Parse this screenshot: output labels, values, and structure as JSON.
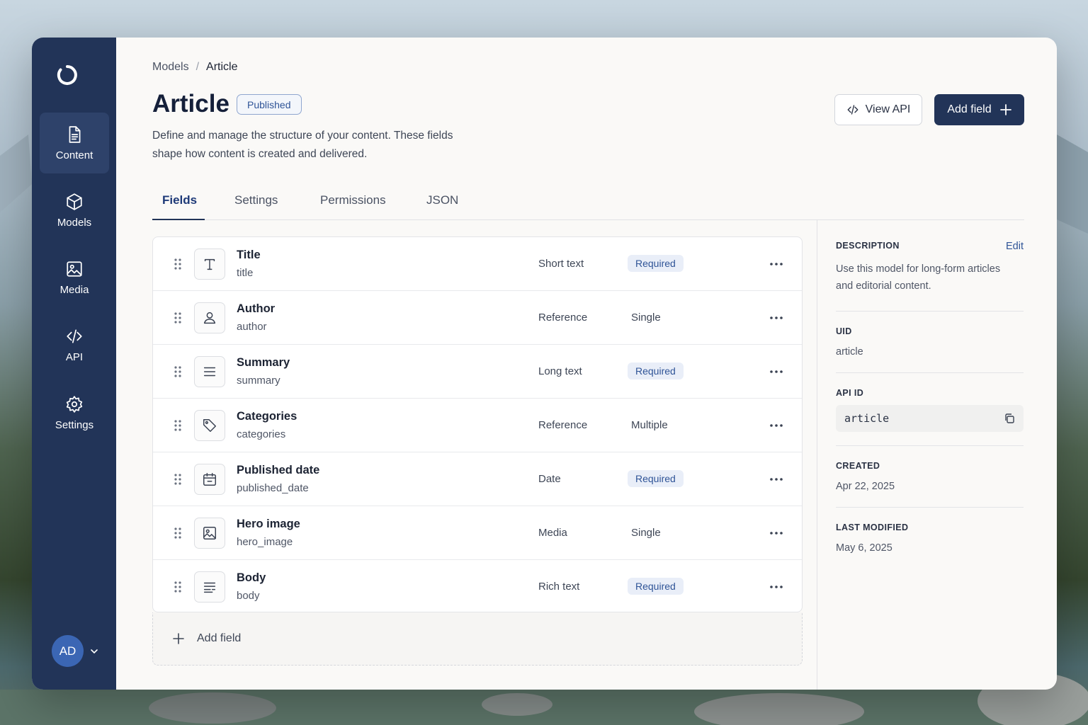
{
  "sidebar": {
    "items": [
      {
        "label": "Content",
        "icon": "file-text-icon",
        "active": true
      },
      {
        "label": "Models",
        "icon": "cube-icon",
        "active": false
      },
      {
        "label": "Media",
        "icon": "image-icon",
        "active": false
      },
      {
        "label": "API",
        "icon": "code-icon",
        "active": false
      },
      {
        "label": "Settings",
        "icon": "gear-icon",
        "active": false
      }
    ],
    "avatar_initials": "AD"
  },
  "breadcrumb": {
    "parent": "Models",
    "separator": "/",
    "current": "Article"
  },
  "header": {
    "title": "Article",
    "status_badge": "Published",
    "description": "Define and manage the structure of your content. These fields shape how content is created and delivered.",
    "view_api_label": "View API",
    "add_field_label": "Add field"
  },
  "tabs": [
    {
      "label": "Fields",
      "active": true
    },
    {
      "label": "Settings",
      "active": false
    },
    {
      "label": "Permissions",
      "active": false
    },
    {
      "label": "JSON",
      "active": false
    }
  ],
  "fields": [
    {
      "name": "Title",
      "key": "title",
      "type": "Short text",
      "tag": "Required",
      "icon": "text-icon"
    },
    {
      "name": "Author",
      "key": "author",
      "type": "Reference",
      "tag": "Single",
      "icon": "user-icon"
    },
    {
      "name": "Summary",
      "key": "summary",
      "type": "Long text",
      "tag": "Required",
      "icon": "lines-icon"
    },
    {
      "name": "Categories",
      "key": "categories",
      "type": "Reference",
      "tag": "Multiple",
      "icon": "tag-icon"
    },
    {
      "name": "Published date",
      "key": "published_date",
      "type": "Date",
      "tag": "Required",
      "icon": "calendar-icon"
    },
    {
      "name": "Hero image",
      "key": "hero_image",
      "type": "Media",
      "tag": "Single",
      "icon": "image-icon"
    },
    {
      "name": "Body",
      "key": "body",
      "type": "Rich text",
      "tag": "Required",
      "icon": "rich-text-icon"
    }
  ],
  "add_field_row_label": "Add field",
  "details": {
    "description_label": "DESCRIPTION",
    "edit_label": "Edit",
    "description_value": "Use this model for long-form articles and editorial content.",
    "uid_label": "UID",
    "uid_value": "article",
    "api_id_label": "API ID",
    "api_id_value": "article",
    "created_label": "CREATED",
    "created_value": "Apr 22, 2025",
    "modified_label": "LAST MODIFIED",
    "modified_value": "May 6, 2025"
  },
  "colors": {
    "sidebar": "#223458",
    "accent": "#2f5497",
    "primary_button": "#223458"
  }
}
